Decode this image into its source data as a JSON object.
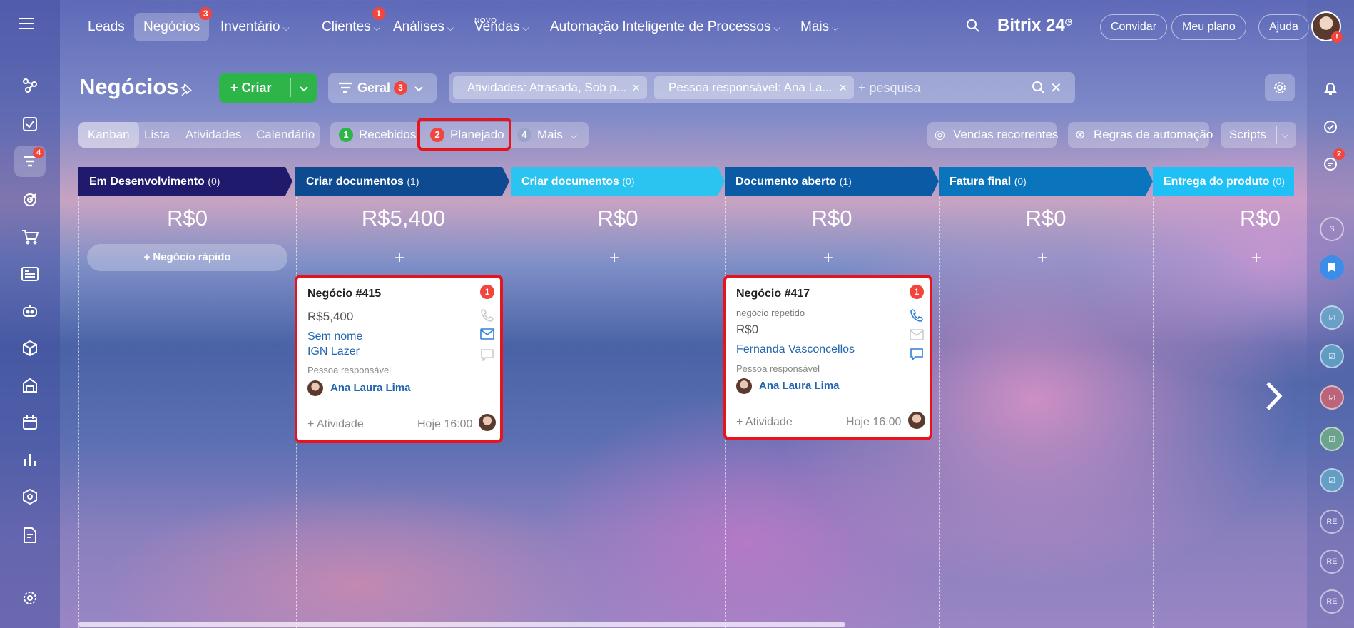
{
  "nav": {
    "items": [
      {
        "label": "Leads"
      },
      {
        "label": "Negócios",
        "badge": "3",
        "active": true
      },
      {
        "label": "Inventário"
      },
      {
        "label": "Clientes",
        "badge": "1"
      },
      {
        "label": "Análises"
      },
      {
        "label": "Vendas",
        "tag": "NOVO"
      },
      {
        "label": "Automação Inteligente de Processos"
      },
      {
        "label": "Mais"
      }
    ],
    "brand": "Bitrix 24",
    "invite": "Convidar",
    "plan": "Meu plano",
    "help": "Ajuda",
    "avatar_badge": "!"
  },
  "sidebar": {
    "badge_crm": "4"
  },
  "rightbar": {
    "chat_badge": "2",
    "labels": [
      "S",
      "RE",
      "RE",
      "RE"
    ]
  },
  "page": {
    "title": "Negócios",
    "create_label": "Criar",
    "general_label": "Geral",
    "general_badge": "3",
    "filter_chip_1": "Atividades: Atrasada, Sob p...",
    "filter_chip_2": "Pessoa responsável: Ana La...",
    "search_placeholder": "+ pesquisa"
  },
  "views": [
    "Kanban",
    "Lista",
    "Atividades",
    "Calendário"
  ],
  "counters": {
    "received": {
      "count": "1",
      "label": "Recebidos",
      "color": "#2db54a"
    },
    "planned": {
      "count": "2",
      "label": "Planejado",
      "color": "#f2453d"
    },
    "more": {
      "count": "4",
      "label": "Mais",
      "color": "#9aa4c8"
    }
  },
  "tools": {
    "recurring": "Vendas recorrentes",
    "automation": "Regras de automação",
    "scripts": "Scripts"
  },
  "columns": [
    {
      "title": "Em Desenvolvimento",
      "count": "(0)",
      "sum": "R$0",
      "color": "#1f1a6b"
    },
    {
      "title": "Criar documentos",
      "count": "(1)",
      "sum": "R$5,400",
      "color": "#0e4a8f"
    },
    {
      "title": "Criar documentos",
      "count": "(0)",
      "sum": "R$0",
      "color": "#2bc4f0"
    },
    {
      "title": "Documento aberto",
      "count": "(1)",
      "sum": "R$0",
      "color": "#0a5aa6"
    },
    {
      "title": "Fatura final",
      "count": "(0)",
      "sum": "R$0",
      "color": "#0a75bd"
    },
    {
      "title": "Entrega do produto",
      "count": "(0)",
      "sum": "R$0",
      "color": "#1ec0f5"
    }
  ],
  "quick_deal": "Negócio rápido",
  "cards": [
    {
      "title": "Negócio #415",
      "badge": "1",
      "amount": "R$5,400",
      "contact": "Sem nome",
      "company": "IGN Lazer",
      "responsible_label": "Pessoa responsável",
      "responsible": "Ana Laura Lima",
      "activity": "+ Atividade",
      "time": "Hoje 16:00"
    },
    {
      "title": "Negócio #417",
      "badge": "1",
      "subtitle": "negócio repetido",
      "amount": "R$0",
      "contact": "Fernanda Vasconcellos",
      "responsible_label": "Pessoa responsável",
      "responsible": "Ana Laura Lima",
      "activity": "+ Atividade",
      "time": "Hoje 16:00"
    }
  ]
}
